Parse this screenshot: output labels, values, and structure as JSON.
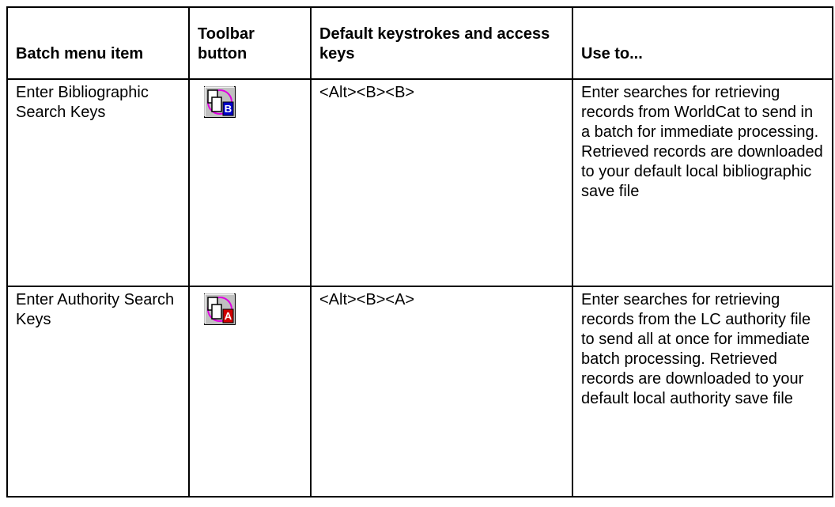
{
  "headers": {
    "col1": "Batch menu item",
    "col2": "Toolbar button",
    "col3": "Default keystrokes and access keys",
    "col4": "Use to..."
  },
  "rows": [
    {
      "item": "Enter Bibliographic Search Keys",
      "icon": "batch-bibliographic-search-icon",
      "icon_letter": "B",
      "icon_color": "#0000c8",
      "keys": "<Alt><B><B>",
      "use": "Enter searches for retrieving records from WorldCat to send in a batch for immediate processing. Retrieved records are downloaded to your default local bibliographic save file"
    },
    {
      "item": "Enter Authority Search Keys",
      "icon": "batch-authority-search-icon",
      "icon_letter": "A",
      "icon_color": "#d00000",
      "keys": "<Alt><B><A>",
      "use": "Enter searches for retrieving records from the LC authority file to send all at once for immediate batch processing. Retrieved records are downloaded to your default local authority save file"
    }
  ]
}
